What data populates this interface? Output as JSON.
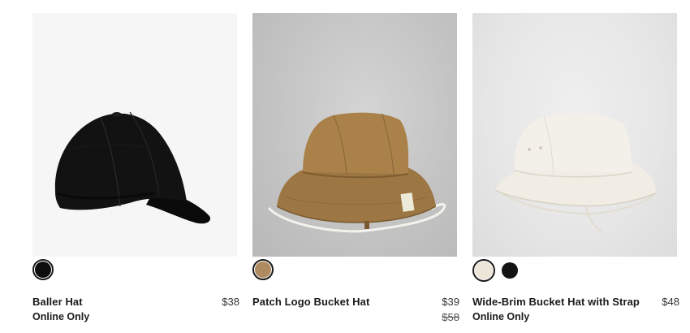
{
  "products": [
    {
      "name": "Baller Hat",
      "price": "$38",
      "badge": "Online Only",
      "image": "black-baseball-cap",
      "swatches": [
        {
          "color": "#0d0d0d",
          "selected": true
        }
      ]
    },
    {
      "name": "Patch Logo Bucket Hat",
      "price": "$39",
      "original_price": "$58",
      "image": "tan-bucket-hat",
      "swatches": [
        {
          "color": "#b08a60",
          "selected": true
        }
      ]
    },
    {
      "name": "Wide-Brim Bucket Hat with Strap",
      "price": "$48",
      "badge": "Online Only",
      "image": "cream-wide-brim-bucket-hat",
      "swatches": [
        {
          "color": "#ede5d8",
          "selected": true
        },
        {
          "color": "#141414",
          "selected": false
        }
      ]
    }
  ]
}
